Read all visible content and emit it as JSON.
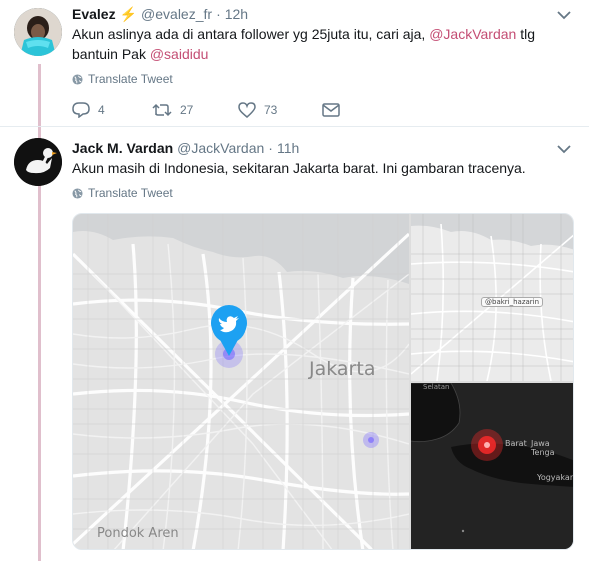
{
  "tweets": [
    {
      "name": "Evalez",
      "emoji": "⚡",
      "handle": "@evalez_fr",
      "dot": "·",
      "time": "12h",
      "text_before": "Akun aslinya ada di antara follower yg 25juta itu, cari aja, ",
      "mention1": "@JackVardan",
      "text_mid": " tlg bantuin Pak ",
      "mention2": "@saididu",
      "translate": "Translate Tweet",
      "replies": "4",
      "retweets": "27",
      "likes": "73"
    },
    {
      "name": "Jack M. Vardan",
      "handle": "@JackVardan",
      "dot": "·",
      "time": "11h",
      "text": "Akun masih di Indonesia, sekitaran Jakarta barat. Ini gambaran tracenya.",
      "translate": "Translate Tweet"
    }
  ],
  "map": {
    "main_labels": {
      "city": "Jakarta",
      "district": "Pondok Aren"
    },
    "top_right_tag": "@bakri_hazarin",
    "bottom_right_labels": {
      "selatan": "Selatan",
      "barat": "Barat",
      "jateng": "Jawa Tenga",
      "yogya": "Yogyakar"
    }
  },
  "colors": {
    "accent": "#c44e74",
    "thread_line": "#e0bfcc",
    "pin": "#1da1f2",
    "hotspot": "#ff2a2a"
  },
  "icons": [
    "caret-down-icon",
    "globe-icon",
    "reply-icon",
    "retweet-icon",
    "like-icon",
    "dm-icon",
    "twitter-bird-icon"
  ]
}
